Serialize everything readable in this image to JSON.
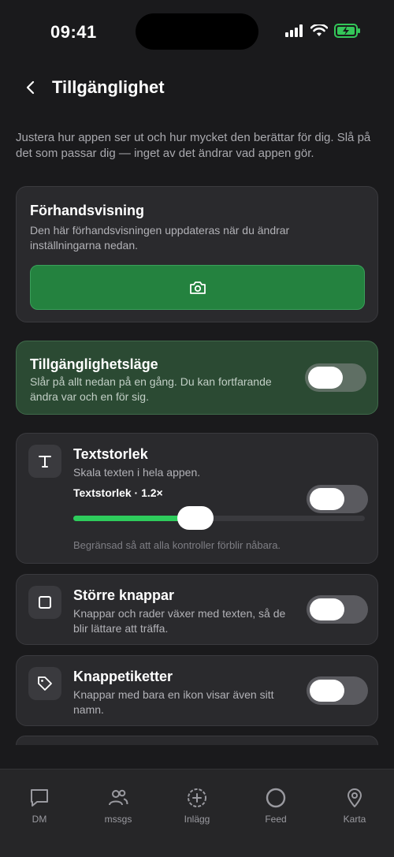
{
  "status": {
    "time": "09:41"
  },
  "header": {
    "title": "Tillgänglighet"
  },
  "intro": "Justera hur appen ser ut och hur mycket den berättar för dig. Slå på det som passar dig — inget av det ändrar vad appen gör.",
  "preview": {
    "title": "Förhandsvisning",
    "subtitle": "Den här förhandsvisningen uppdateras när du ändrar inställningarna nedan.",
    "button_icon": "camera-icon"
  },
  "accessibility_mode": {
    "title": "Tillgänglighetsläge",
    "subtitle": "Slår på allt nedan på en gång. Du kan fortfarande ändra var och en för sig.",
    "enabled": false
  },
  "text_size": {
    "icon": "text-icon",
    "title": "Textstorlek",
    "subtitle": "Skala texten i hela appen.",
    "slider_label": "Textstorlek · 1.2×",
    "slider_value": 0.42,
    "note": "Begränsad så att alla kontroller förblir nåbara.",
    "enabled": false
  },
  "bigger_buttons": {
    "icon": "square-icon",
    "title": "Större knappar",
    "subtitle": "Knappar och rader växer med texten, så de blir lättare att träffa.",
    "enabled": false
  },
  "button_labels": {
    "icon": "tag-icon",
    "title": "Knappetiketter",
    "subtitle": "Knappar med bara en ikon visar även sitt namn.",
    "enabled": false
  },
  "tabs": [
    {
      "label": "DM",
      "icon": "chat-bubble-icon"
    },
    {
      "label": "mssgs",
      "icon": "people-icon"
    },
    {
      "label": "Inlägg",
      "icon": "plus-circle-icon"
    },
    {
      "label": "Feed",
      "icon": "circle-icon"
    },
    {
      "label": "Karta",
      "icon": "map-pin-icon"
    }
  ],
  "colors": {
    "accent": "#24823f",
    "background": "#1a1a1c",
    "card": "#2a2a2d"
  }
}
